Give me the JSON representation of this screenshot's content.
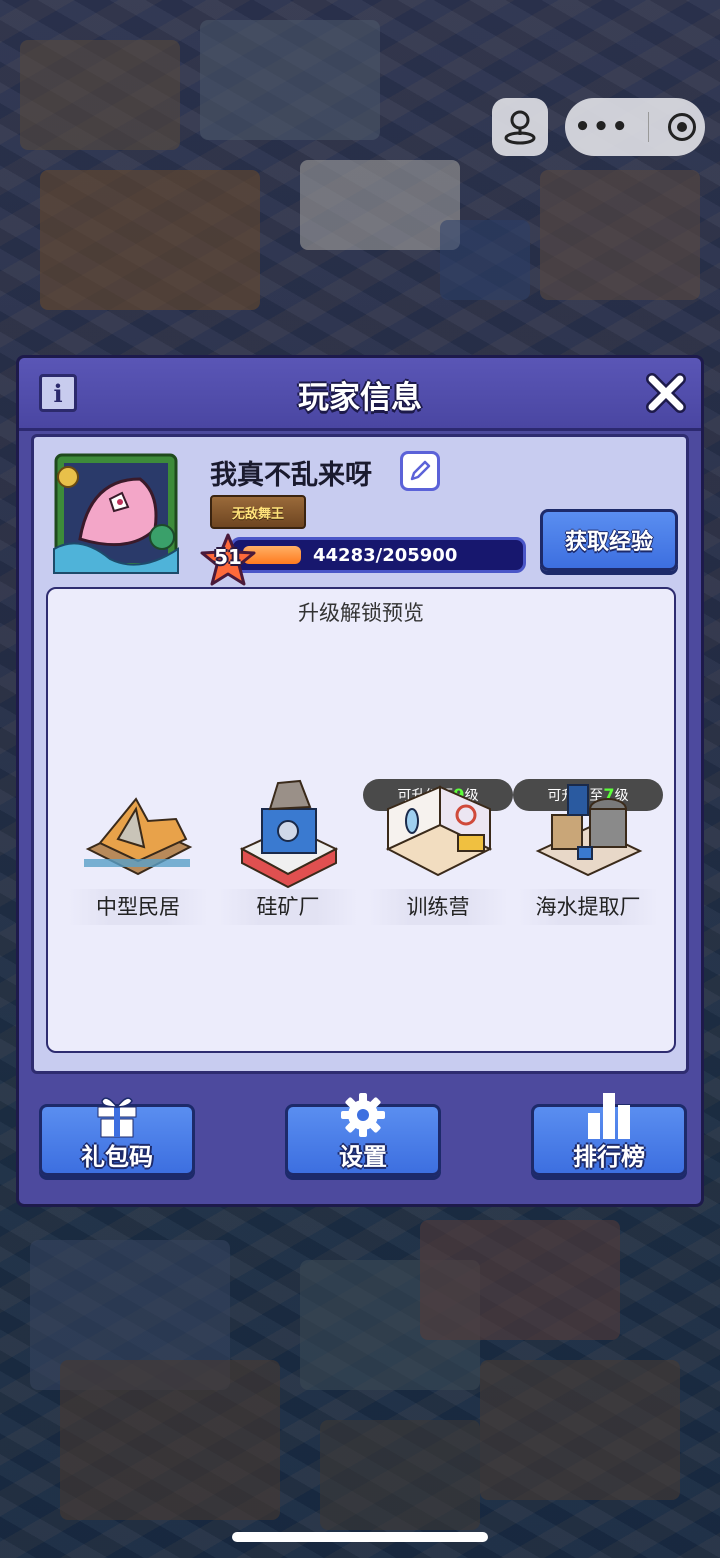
{
  "dialog": {
    "title": "玩家信息"
  },
  "player": {
    "name": "我真不乱来呀",
    "title_badge": "无敌舞王",
    "level": "51",
    "xp_text": "44283/205900",
    "xp_current": 44283,
    "xp_max": 205900,
    "get_exp_label": "获取经验"
  },
  "preview": {
    "title": "升级解锁预览",
    "buildings": [
      {
        "name": "中型民居",
        "upgrade_prefix": "",
        "upgrade_level": "",
        "upgrade_suffix": ""
      },
      {
        "name": "硅矿厂",
        "upgrade_prefix": "",
        "upgrade_level": "",
        "upgrade_suffix": ""
      },
      {
        "name": "训练营",
        "upgrade_prefix": "可升级至",
        "upgrade_level": "9",
        "upgrade_suffix": "级"
      },
      {
        "name": "海水提取厂",
        "upgrade_prefix": "可升级至",
        "upgrade_level": "7",
        "upgrade_suffix": "级"
      }
    ]
  },
  "buttons": {
    "gift_code": "礼包码",
    "settings": "设置",
    "leaderboard": "排行榜"
  },
  "icons": {
    "info": "info-icon",
    "close": "close-icon",
    "edit": "pencil-icon",
    "gift": "gift-icon",
    "gear": "gear-icon",
    "chart": "bar-chart-icon"
  },
  "colors": {
    "dialog_bg": "#4d4a9e",
    "panel_bg": "#c8ccf0",
    "button_blue": "#3d6fe0",
    "xp_fill": "#ff7a1f",
    "upgrade_level": "#5dff3a"
  }
}
